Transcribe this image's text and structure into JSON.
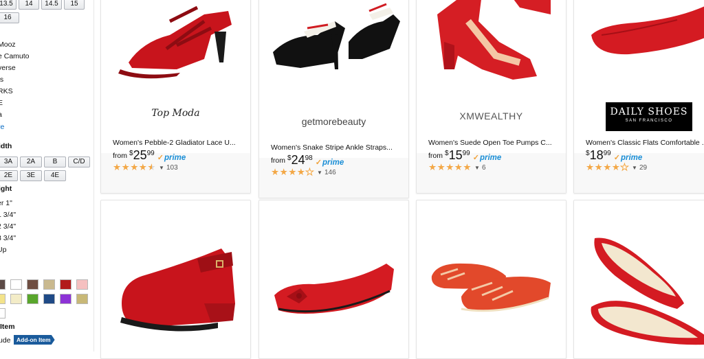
{
  "sidebar": {
    "sizes_row1": [
      "13.5",
      "14",
      "14.5",
      "15"
    ],
    "sizes_row2": [
      "16"
    ],
    "brands": [
      "Mooz",
      "e Camuto",
      "verse",
      "ts",
      "RKS",
      "E",
      "a"
    ],
    "see_more": "re",
    "width_heading": "idth",
    "widths_row1": [
      "3A",
      "2A",
      "B",
      "C/D"
    ],
    "widths_row2": [
      "2E",
      "3E",
      "4E"
    ],
    "heel_heading": "ight",
    "heel_options": [
      "er 1\"",
      "1 3/4\"",
      "2 3/4\"",
      "3 3/4\"",
      " Up"
    ],
    "colors": [
      "#5c4a46",
      "#ffffff",
      "#6f4e42",
      "#c9b98f",
      "#b21a1a",
      "#f5c0c0",
      "#f3e38a",
      "#f3ecc7",
      "#59a62c",
      "#1f4a86",
      "#8d33d6",
      "#c8b877",
      "#ffffff"
    ],
    "addon_section_label": "Item",
    "include_label": "ude",
    "addon_badge": "Add-on Item"
  },
  "products": [
    {
      "brand": "Top Moda",
      "title": "Women's Pebble-2 Gladiator Lace U...",
      "from": "from",
      "currency": "$",
      "price_whole": "25",
      "price_cents": "99",
      "prime": "prime",
      "rating": 4.5,
      "reviews": "103"
    },
    {
      "brand": "getmorebeauty",
      "title": "Women's Snake Stripe Ankle Straps...",
      "from": "from",
      "currency": "$",
      "price_whole": "24",
      "price_cents": "98",
      "prime": "prime",
      "rating": 4,
      "reviews": "146"
    },
    {
      "brand": "XMWEALTHY",
      "title": "Women's Suede Open Toe Pumps C...",
      "from": "from",
      "currency": "$",
      "price_whole": "15",
      "price_cents": "99",
      "prime": "prime",
      "rating": 5,
      "reviews": "6"
    },
    {
      "brand": "DAILY SHOES",
      "brand_sub": "SAN FRANCISCO",
      "title": "Women's Classic Flats Comfortable ...",
      "from": "",
      "currency": "$",
      "price_whole": "18",
      "price_cents": "99",
      "prime": "prime",
      "rating": 4,
      "reviews": "29"
    }
  ],
  "accent_colors": {
    "link": "#0066c0",
    "prime": "#1a8ed6",
    "star": "#f3a847",
    "shoe_red": "#c8141c"
  },
  "icons": [
    "star-icon",
    "prime-check-icon",
    "caret-down-icon"
  ]
}
